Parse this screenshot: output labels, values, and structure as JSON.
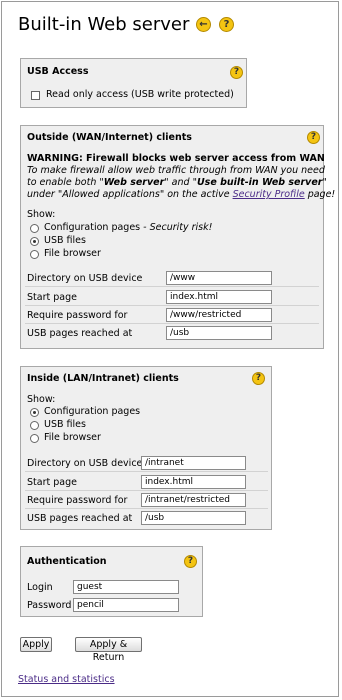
{
  "header": {
    "title": "Built-in Web server",
    "back_icon": "arrow-left-icon",
    "help_icon": "question-icon"
  },
  "usb_access": {
    "title": "USB Access",
    "read_only_label": "Read only access (USB write protected)",
    "read_only_checked": false
  },
  "wan": {
    "title": "Outside (WAN/Internet) clients",
    "warning": "WARNING: Firewall blocks web server access from WAN",
    "info_line1": "To make firewall allow web traffic through from WAN you need",
    "info_l2_a": "to enable both \"",
    "info_l2_b": "Web server",
    "info_l2_c": "\" and \"",
    "info_l2_d": "Use built-in Web server",
    "info_l2_e": "\"",
    "info_l3_a": "under \"Allowed applications\" on the active ",
    "info_l3_link": "Security Profile",
    "info_l3_b": " page!",
    "show_label": "Show:",
    "options": [
      {
        "label": "Configuration pages",
        "note": " - Security risk!",
        "selected": false
      },
      {
        "label": "USB files",
        "selected": true
      },
      {
        "label": "File browser",
        "selected": false
      }
    ],
    "fields": [
      {
        "label": "Directory on USB device",
        "value": "/www"
      },
      {
        "label": "Start page",
        "value": "index.html"
      },
      {
        "label": "Require password for",
        "value": "/www/restricted"
      },
      {
        "label": "USB pages reached at",
        "value": "/usb"
      }
    ]
  },
  "lan": {
    "title": "Inside (LAN/Intranet) clients",
    "show_label": "Show:",
    "options": [
      {
        "label": "Configuration pages",
        "selected": true
      },
      {
        "label": "USB files",
        "selected": false
      },
      {
        "label": "File browser",
        "selected": false
      }
    ],
    "fields": [
      {
        "label": "Directory on USB device",
        "value": "/intranet"
      },
      {
        "label": "Start page",
        "value": "index.html"
      },
      {
        "label": "Require password for",
        "value": "/intranet/restricted"
      },
      {
        "label": "USB pages reached at",
        "value": "/usb"
      }
    ]
  },
  "auth": {
    "title": "Authentication",
    "login_label": "Login",
    "login_value": "guest",
    "password_label": "Password",
    "password_value": "pencil"
  },
  "buttons": {
    "apply": "Apply",
    "apply_return": "Apply & Return"
  },
  "footer": {
    "status_link": "Status and statistics"
  },
  "colors": {
    "accent_yellow": "#f4c412",
    "panel_bg": "#efefef",
    "link": "#4a2b87"
  }
}
